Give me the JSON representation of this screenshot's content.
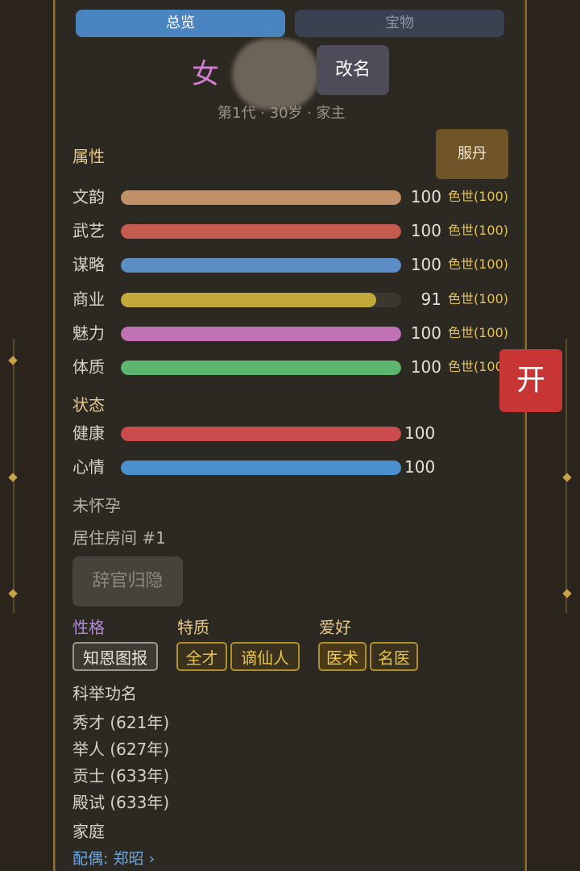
{
  "tabs": {
    "overview": "总览",
    "treasure": "宝物"
  },
  "profile": {
    "gender": "女",
    "rename_label": "改名",
    "subline": "第1代 · 30岁 · 家主"
  },
  "attributes": {
    "title": "属性",
    "pill_label": "服丹",
    "items": [
      {
        "label": "文韵",
        "value": "100",
        "cap": "色世(100)",
        "fraction": 1.0,
        "color": "#c09069"
      },
      {
        "label": "武艺",
        "value": "100",
        "cap": "色世(100)",
        "fraction": 1.0,
        "color": "#c55b4e"
      },
      {
        "label": "谋略",
        "value": "100",
        "cap": "色世(100)",
        "fraction": 1.0,
        "color": "#5c8ec5"
      },
      {
        "label": "商业",
        "value": "91",
        "cap": "色世(100)",
        "fraction": 0.91,
        "color": "#c1a93a"
      },
      {
        "label": "魅力",
        "value": "100",
        "cap": "色世(100)",
        "fraction": 1.0,
        "color": "#c172b5"
      },
      {
        "label": "体质",
        "value": "100",
        "cap": "色世(100",
        "fraction": 1.0,
        "color": "#5db56f"
      }
    ]
  },
  "status": {
    "title": "状态",
    "items": [
      {
        "label": "健康",
        "value": "100",
        "fraction": 1.0,
        "color": "#c94b4b"
      },
      {
        "label": "心情",
        "value": "100",
        "fraction": 1.0,
        "color": "#4a90cc"
      }
    ],
    "pregnancy": "未怀孕",
    "room": "居住房间 #1",
    "retire_label": "辞官归隐"
  },
  "traits": {
    "personality_title": "性格",
    "quality_title": "特质",
    "hobby_title": "爱好",
    "personality": [
      "知恩图报"
    ],
    "quality": [
      "全才",
      "谪仙人"
    ],
    "hobby": [
      "医术",
      "名医"
    ]
  },
  "exam": {
    "title": "科举功名",
    "items": [
      "秀才 (621年)",
      "举人 (627年)",
      "贡士 (633年)",
      "殿试 (633年)"
    ]
  },
  "family": {
    "title": "家庭",
    "spouse": "配偶: 郑昭 ›"
  },
  "open_button": "开",
  "colors": {
    "accent": "#4a85c2",
    "gold": "#e3c25a",
    "panel": "#2c2822"
  }
}
